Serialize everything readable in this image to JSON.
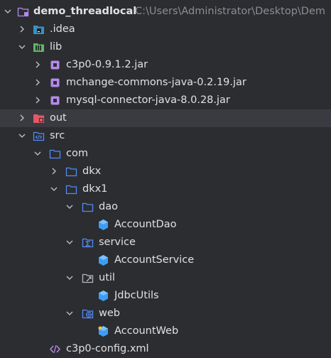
{
  "project": {
    "name": "demo_threadlocal",
    "path": "C:\\Users\\Administrator\\Desktop\\Dem"
  },
  "tree": {
    "idea": ".idea",
    "lib": "lib",
    "jar1": "c3p0-0.9.1.2.jar",
    "jar2": "mchange-commons-java-0.2.19.jar",
    "jar3": "mysql-connector-java-8.0.28.jar",
    "out": "out",
    "src": "src",
    "com": "com",
    "dkx": "dkx",
    "dkx1": "dkx1",
    "dao": "dao",
    "account_dao": "AccountDao",
    "service": "service",
    "account_service": "AccountService",
    "util": "util",
    "jdbc_utils": "JdbcUtils",
    "web": "web",
    "account_web": "AccountWeb",
    "config": "c3p0-config.xml"
  },
  "colors": {
    "background": "#2b2d30",
    "selection": "#393b40",
    "text": "#dfe1e5",
    "path_text": "#8a8d93",
    "folder_outline": "#548af7",
    "class_icon": "#3d9df3",
    "jar_icon": "#b589ec",
    "excluded_folder": "#e55765",
    "library_folder": "#5fb865"
  }
}
